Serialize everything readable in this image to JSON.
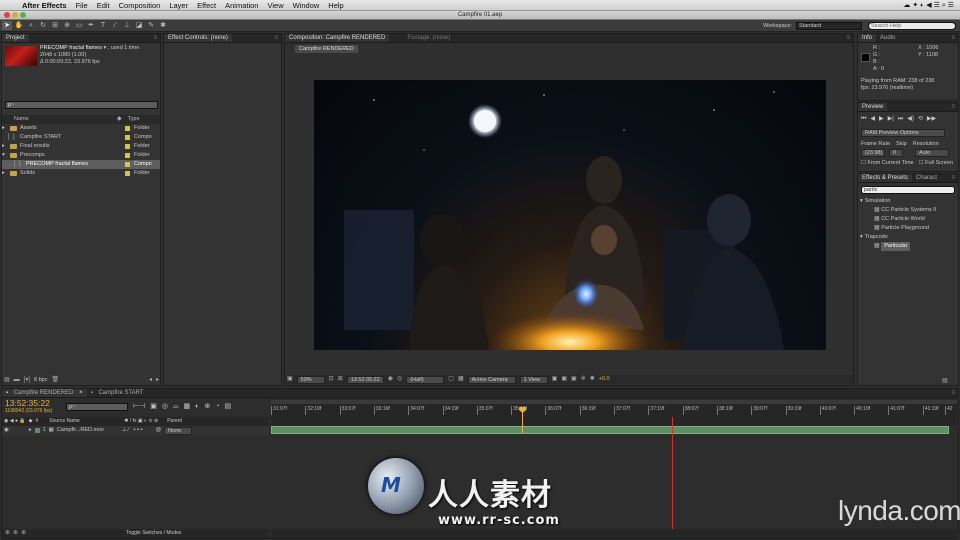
{
  "menubar": {
    "app": "After Effects",
    "items": [
      "File",
      "Edit",
      "Composition",
      "Layer",
      "Effect",
      "Animation",
      "View",
      "Window",
      "Help"
    ]
  },
  "window": {
    "title": "Campfire 01.aep"
  },
  "toolbar": {
    "workspace_label": "Workspace:",
    "workspace_value": "Standard",
    "search_placeholder": "Search Help"
  },
  "project": {
    "tab": "Project",
    "selected_name": "PRECOMP fractal flames",
    "used": ", used 1 time",
    "size": "2048 x 1080 (1.00)",
    "duration": "Δ 0:00:09:22, 23.976 fps",
    "search_value": "ρ~",
    "col_name": "Name",
    "col_type": "Type",
    "items": [
      {
        "name": "Assets",
        "type": "Folder"
      },
      {
        "name": "Campfire START",
        "type": "Compo"
      },
      {
        "name": "Final results",
        "type": "Folder"
      },
      {
        "name": "Precomps",
        "type": "Folder"
      },
      {
        "name": "PRECOMP fractal flames",
        "type": "Compo"
      },
      {
        "name": "Solids",
        "type": "Folder"
      }
    ],
    "bpc": "8 bpc"
  },
  "effect_controls": {
    "tab": "Effect Controls: (none)"
  },
  "composition": {
    "tab": "Composition: Campfire RENDERED",
    "footage_tab": "Footage: (none)",
    "sub_tab": "Campfire RENDERED",
    "zoom": "50%",
    "timecode": "13:52:35:22",
    "resolution": "(Half)",
    "camera": "Active Camera",
    "view": "1 View",
    "exposure": "+0.0"
  },
  "info": {
    "tab": "Info",
    "audio_tab": "Audio",
    "r": "R :",
    "g": "G :",
    "b": "B :",
    "a": "A : 0",
    "x": "X : 1006",
    "y": "Y : 1108",
    "playing": "Playing from RAM: 238 of 238",
    "fps": "fps: 23.976 (realtime)"
  },
  "preview": {
    "tab": "Preview",
    "options": "RAM Preview Options",
    "frame_rate_label": "Frame Rate",
    "skip_label": "Skip",
    "resolution_label": "Resolution",
    "frame_rate": "(23.98)",
    "skip": "0",
    "resolution": "Auto",
    "from_current": "From Current Time",
    "full_screen": "Full Screen"
  },
  "effects": {
    "tab": "Effects & Presets",
    "char_tab": "Charact",
    "search_value": "partic",
    "groups": [
      {
        "name": "Simulation",
        "items": [
          "CC Particle Systems II",
          "CC Particle World",
          "Particle Playground"
        ]
      },
      {
        "name": "Trapcode",
        "items": [
          "Particular"
        ]
      }
    ]
  },
  "timeline": {
    "tabs": [
      "Campfire RENDERED",
      "Campfire START"
    ],
    "timecode": "13:52:35:22",
    "frame_info": "1198942 (23.976 fps)",
    "col_source": "Source Name",
    "col_parent": "Parent",
    "layer_num": "1",
    "layer_name": "Campfir...RED.mov",
    "parent_value": "None",
    "toggle_label": "Toggle Switches / Modes",
    "ruler": [
      "31:07f",
      "32:19f",
      "33:07f",
      "33:19f",
      "34:07f",
      "34:19f",
      "35:07f",
      "35:19f",
      "36:07f",
      "36:19f",
      "37:07f",
      "37:19f",
      "38:07f",
      "38:19f",
      "39:07f",
      "39:19f",
      "40:07f",
      "40:19f",
      "41:07f",
      "41:19f",
      "42"
    ],
    "playhead": 0.366,
    "red_marker": 0.585
  },
  "watermark": {
    "brand_cn": "人人素材",
    "url": "www.rr-sc.com",
    "lynda": "lynda.com"
  },
  "colors": {
    "accent_timecode": "#e6b23a",
    "folder": "#c6a24a",
    "layer_bar": "#5d8f62",
    "playhead": "#e6b23a"
  }
}
